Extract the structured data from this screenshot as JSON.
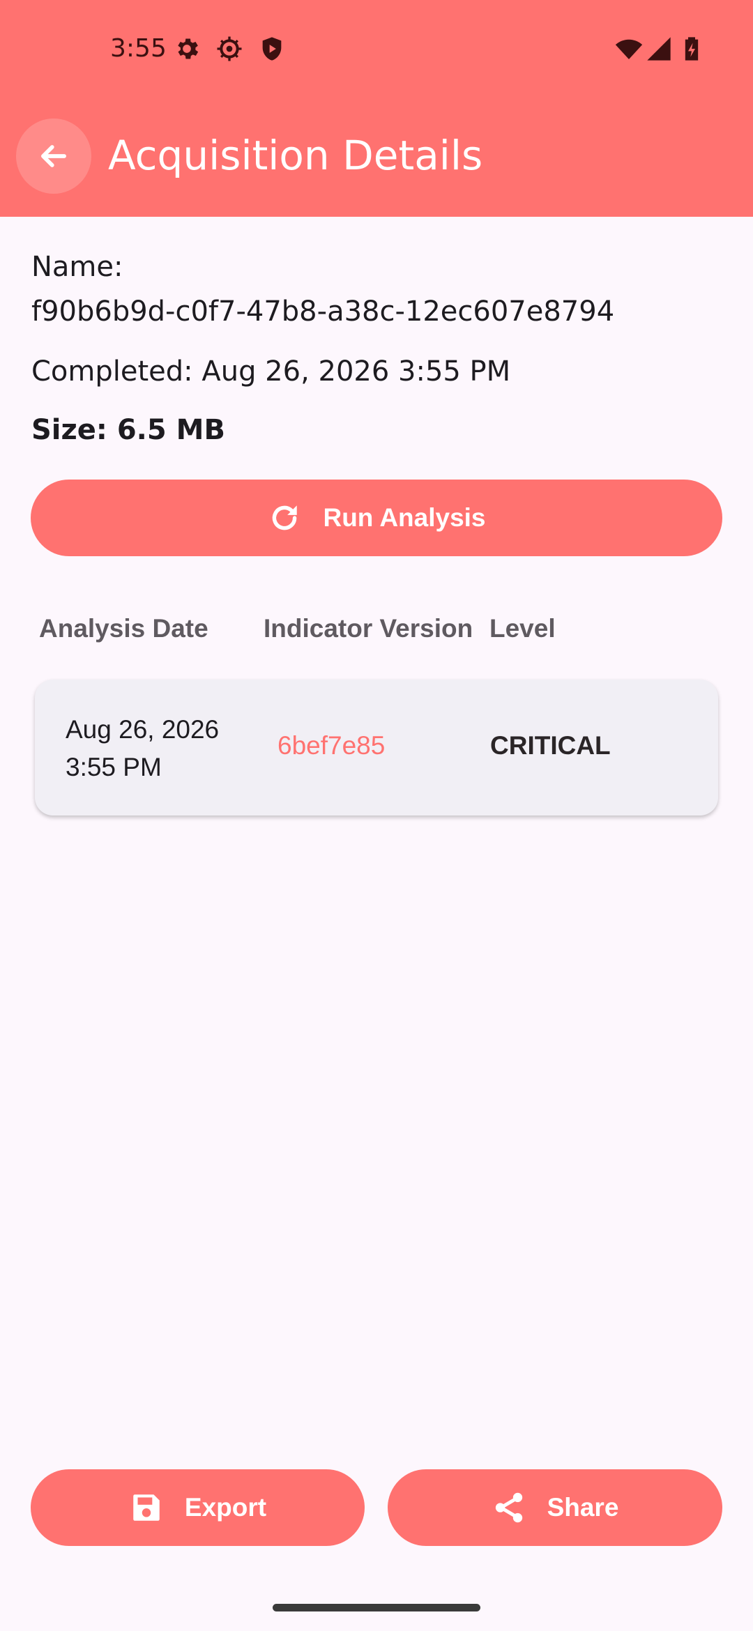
{
  "status_bar": {
    "time": "3:55",
    "left_icons": [
      "settings-gear-icon",
      "sync-gear-icon",
      "shield-play-icon"
    ],
    "right_icons": [
      "wifi-icon",
      "cell-signal-icon",
      "battery-charging-icon"
    ]
  },
  "app_bar": {
    "title": "Acquisition Details",
    "back_icon": "arrow-back-icon",
    "color": "#ff7270"
  },
  "details": {
    "name_label": "Name:",
    "name_value": "f90b6b9d-c0f7-47b8-a38c-12ec607e8794",
    "completed": "Completed: Aug 26, 2026 3:55 PM",
    "size": "Size: 6.5 MB"
  },
  "run_button": {
    "label": "Run Analysis",
    "icon": "refresh-icon"
  },
  "table": {
    "columns": [
      "Analysis Date",
      "Indicator Version",
      "Level"
    ],
    "rows": [
      {
        "date": "Aug 26, 2026\n3:55 PM",
        "version": "6bef7e85",
        "level": "CRITICAL"
      }
    ]
  },
  "actions": {
    "export_label": "Export",
    "export_icon": "save-icon",
    "share_label": "Share",
    "share_icon": "share-icon"
  }
}
